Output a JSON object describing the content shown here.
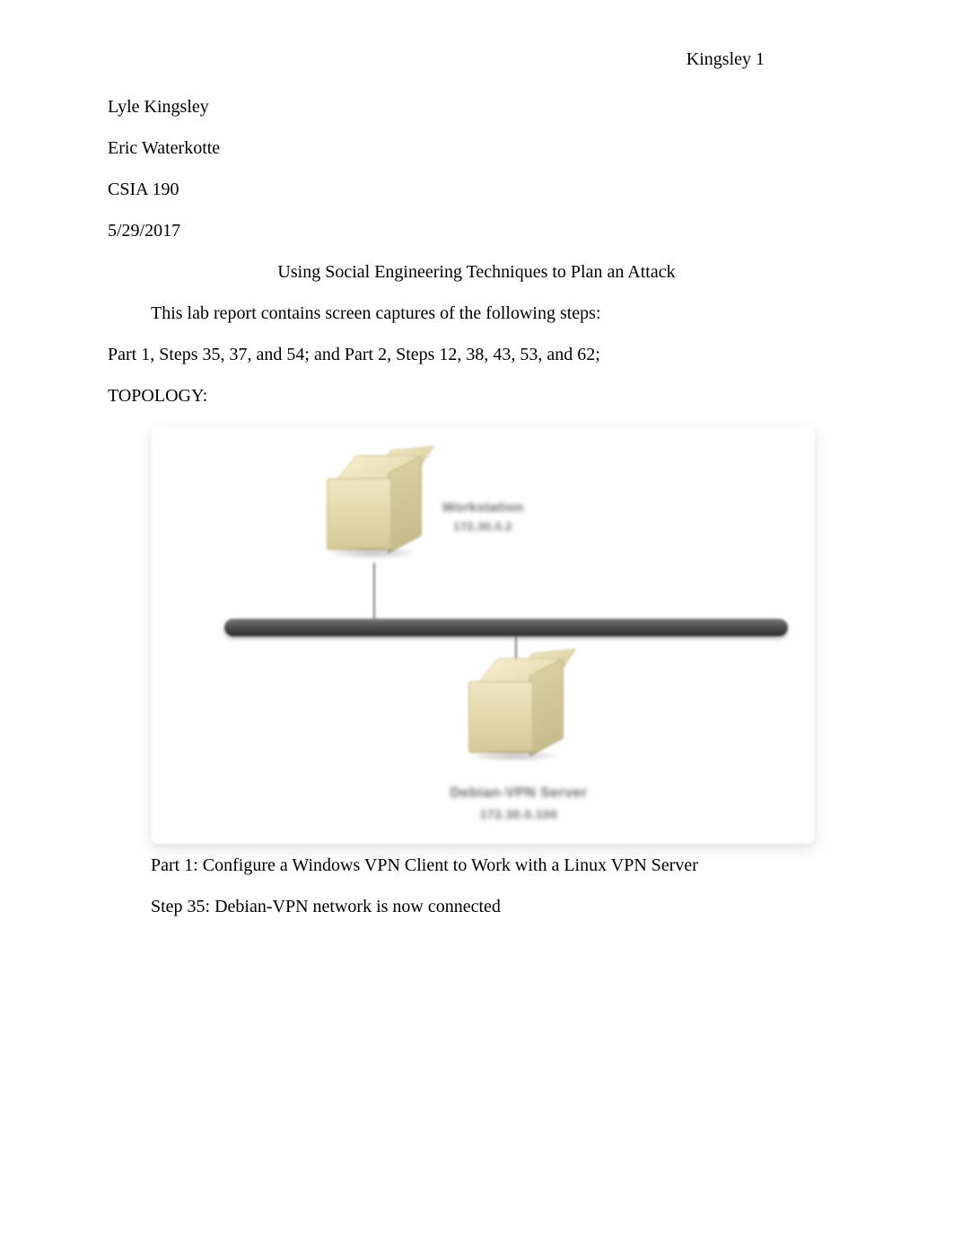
{
  "header": {
    "running_head": "Kingsley 1"
  },
  "front_matter": {
    "author": "Lyle Kingsley",
    "instructor": "Eric Waterkotte",
    "course": "CSIA 190",
    "date": "5/29/2017"
  },
  "title": "Using Social Engineering Techniques to Plan an Attack",
  "body": {
    "intro": "This lab report contains screen captures of the following steps:",
    "steps_summary": "Part 1, Steps 35, 37, and 54; and Part 2, Steps 12, 38, 43, 53, and 62;",
    "topology_heading": "TOPOLOGY:"
  },
  "figure": {
    "top_node_label_1": "Workstation",
    "top_node_label_2": "172.30.0.2",
    "bottom_node_label_1": "Debian-VPN Server",
    "bottom_node_label_2": "172.30.0.100"
  },
  "after_figure": {
    "part1_heading": "Part 1: Configure a Windows VPN Client to Work with a Linux VPN Server",
    "step35": "Step 35: Debian-VPN network is now connected"
  }
}
